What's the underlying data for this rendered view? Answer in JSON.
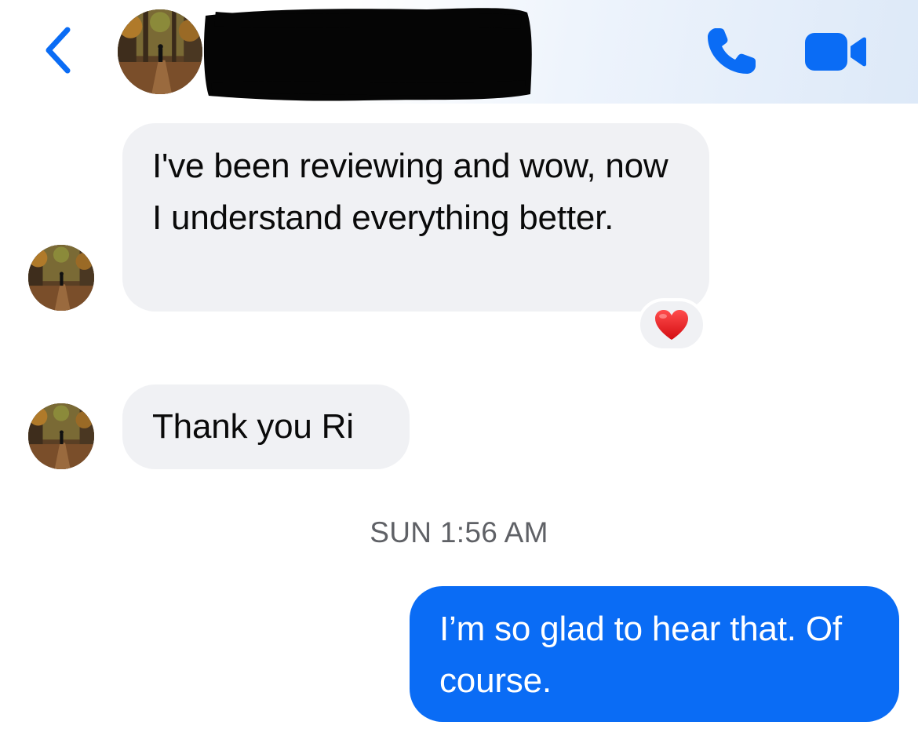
{
  "header": {
    "back_icon": "chevron-left-icon",
    "contact_avatar": "avatar-photo-forest-path",
    "contact_name_redacted": true,
    "phone_icon": "phone-icon",
    "video_icon": "video-camera-icon",
    "accent_color": "#0a6cf5"
  },
  "messages": [
    {
      "direction": "incoming",
      "text": "I've been reviewing and wow, now I understand everything better.",
      "reaction": "❤️"
    },
    {
      "direction": "incoming",
      "text": "Thank you Ri"
    },
    {
      "direction": "outgoing",
      "text": "I’m so glad to hear that. Of course."
    }
  ],
  "timestamp": "SUN 1:56 AM",
  "colors": {
    "incoming_bubble": "#f0f1f4",
    "outgoing_bubble": "#0a6cf5",
    "timestamp_text": "#5f6166"
  }
}
